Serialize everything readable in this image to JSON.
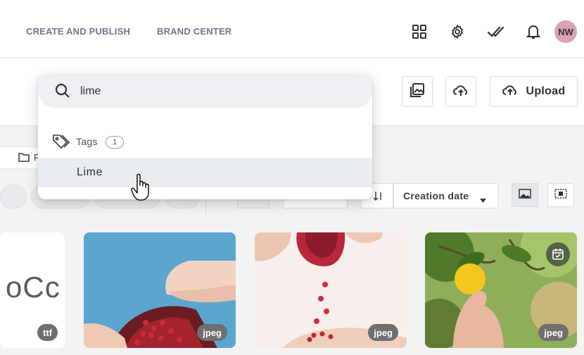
{
  "nav": {
    "links": [
      "CREATE AND PUBLISH",
      "BRAND CENTER"
    ],
    "avatar_initials": "NW"
  },
  "toolbar": {
    "upload_label": "Upload"
  },
  "search": {
    "query": "lime",
    "section_label": "Tags",
    "section_count": "1",
    "results": [
      "Lime"
    ]
  },
  "filters": {
    "breadcrumb_text": "F",
    "sort_label": "Creation date"
  },
  "assets": [
    {
      "preview_text": "oCc",
      "type": "ttf"
    },
    {
      "type": "jpeg"
    },
    {
      "type": "jpeg"
    },
    {
      "type": "jpeg"
    }
  ],
  "colors": {
    "accent": "#2f3237",
    "avatar_bg": "#d8a3b5",
    "badge_bg": "#6f6f72",
    "highlight_row": "#e9ecf1"
  }
}
